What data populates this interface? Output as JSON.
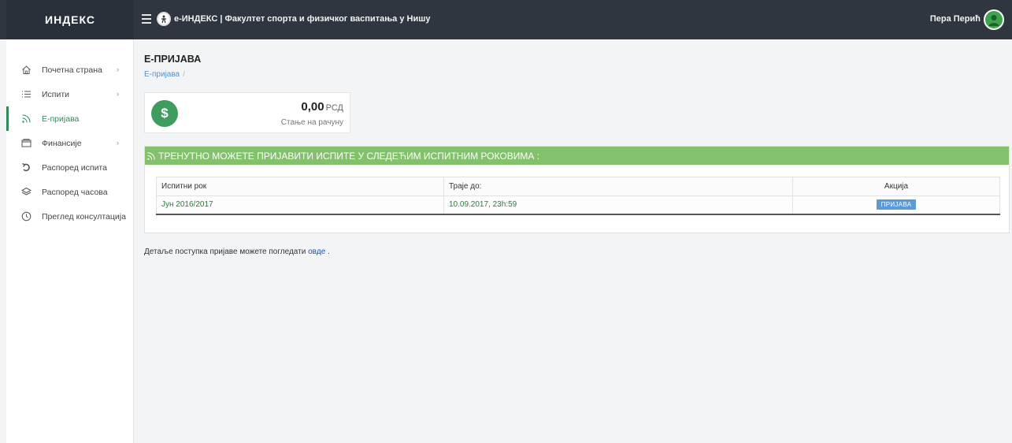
{
  "topbar": {
    "brand": "ИНДЕКС",
    "app_title": "е-ИНДЕКС | Факултет спорта и физичког васпитања у Нишу",
    "user_name": "Пера Перић"
  },
  "sidebar": {
    "items": [
      {
        "label": "Почетна страна",
        "icon": "home-icon",
        "has_submenu": true
      },
      {
        "label": "Испити",
        "icon": "list-icon",
        "has_submenu": true
      },
      {
        "label": "Е-пријава",
        "icon": "rss-icon",
        "has_submenu": false,
        "active": true
      },
      {
        "label": "Финансије",
        "icon": "wallet-icon",
        "has_submenu": true
      },
      {
        "label": "Распоред испита",
        "icon": "undo-icon",
        "has_submenu": false
      },
      {
        "label": "Распоред часова",
        "icon": "layers-icon",
        "has_submenu": false
      },
      {
        "label": "Преглед консултација",
        "icon": "clock-icon",
        "has_submenu": false
      }
    ]
  },
  "main": {
    "title": "Е-ПРИЈАВА",
    "breadcrumb": {
      "item": "Е-пријава",
      "separator": "/"
    },
    "balance": {
      "amount": "0,00",
      "currency": "РСД",
      "caption": "Стање на рачуну",
      "icon": "$"
    },
    "exam_panel": {
      "header": "ТРЕНУТНО МОЖЕТЕ ПРИЈАВИТИ ИСПИТЕ У СЛЕДЕЋИМ ИСПИТНИМ РОКОВИМА :",
      "columns": [
        "Испитни рок",
        "Траје до:",
        "Акција"
      ],
      "rows": [
        {
          "term": "Јун 2016/2017",
          "deadline": "10.09.2017, 23h:59",
          "action": "ПРИЈАВА"
        }
      ]
    },
    "note": {
      "text": "Детаље поступка пријаве можете погледати",
      "link": "овде",
      "suffix": "."
    }
  },
  "colors": {
    "topbar": "#2f3640",
    "accent_green": "#84c16c",
    "coin_green": "#3e9c5e",
    "active_green": "#2e8b57",
    "button_blue": "#5b9bd5"
  }
}
